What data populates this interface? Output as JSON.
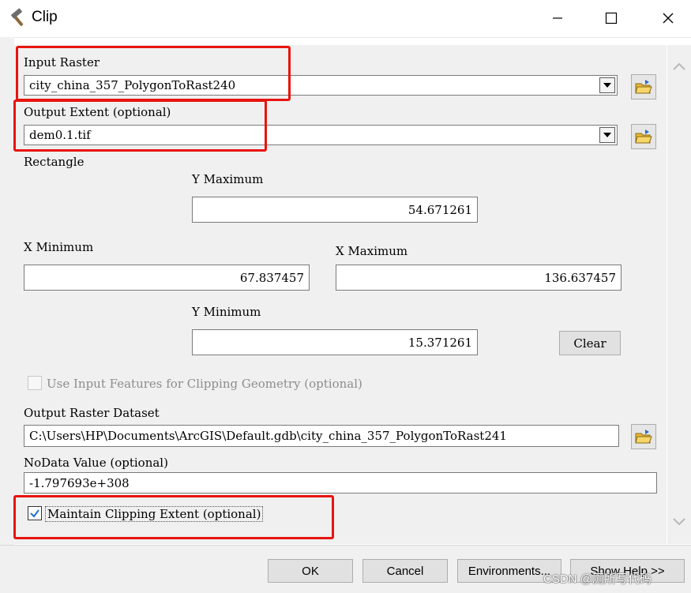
{
  "window": {
    "title": "Clip"
  },
  "input_raster": {
    "label": "Input Raster",
    "value": "city_china_357_PolygonToRast240"
  },
  "output_extent": {
    "label": "Output Extent (optional)",
    "value": "dem0.1.tif"
  },
  "rectangle": {
    "label": "Rectangle",
    "y_max_label": "Y Maximum",
    "y_max": "54.671261",
    "x_min_label": "X Minimum",
    "x_min": "67.837457",
    "x_max_label": "X Maximum",
    "x_max": "136.637457",
    "y_min_label": "Y Minimum",
    "y_min": "15.371261",
    "clear_label": "Clear"
  },
  "use_input_features": {
    "label": "Use Input Features for Clipping Geometry (optional)",
    "checked": false
  },
  "output_raster": {
    "label": "Output Raster Dataset",
    "value": "C:\\Users\\HP\\Documents\\ArcGIS\\Default.gdb\\city_china_357_PolygonToRast241"
  },
  "nodata": {
    "label": "NoData Value (optional)",
    "value": "-1.797693e+308"
  },
  "maintain_extent": {
    "label": "Maintain Clipping Extent (optional)",
    "checked": true
  },
  "buttons": {
    "ok": "OK",
    "cancel": "Cancel",
    "environments": "Environments...",
    "show_help": "Show Help >>"
  },
  "watermark": "CSDN @厕所写代码",
  "colors": {
    "highlight": "#e8140f",
    "dialog_bg": "#f0f0f0"
  }
}
